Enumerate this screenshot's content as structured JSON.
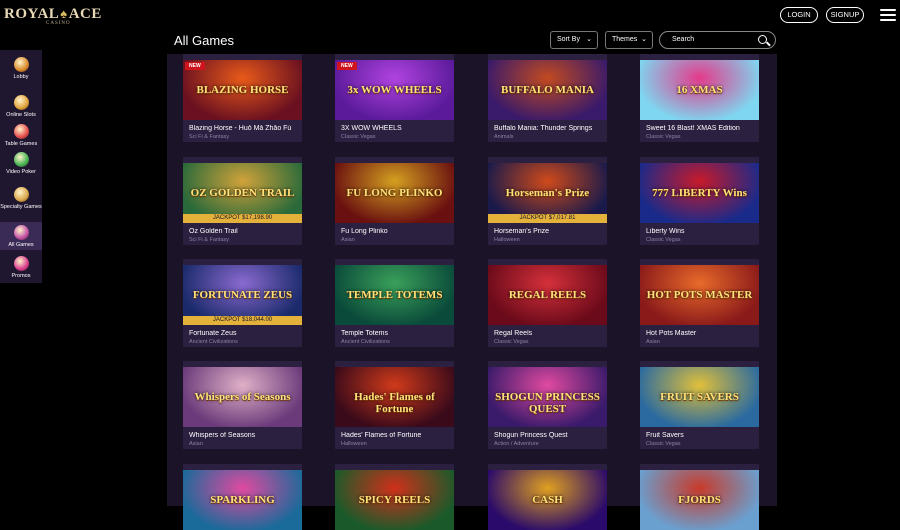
{
  "brand": {
    "name_left": "ROYAL",
    "name_right": "ACE",
    "sub": "CASINO"
  },
  "header": {
    "login": "LOGIN",
    "signup": "SIGNUP"
  },
  "sidebar": {
    "items": [
      {
        "label": "Lobby",
        "icon": "lobby-icon",
        "color": "#d98a2b"
      },
      {
        "label": "Online Slots",
        "icon": "slots-icon",
        "color": "#e0a23a"
      },
      {
        "label": "Table Games",
        "icon": "table-games-icon",
        "color": "#e24b4b"
      },
      {
        "label": "Video Poker",
        "icon": "video-poker-icon",
        "color": "#3fb24f"
      },
      {
        "label": "Specialty Games",
        "icon": "specialty-games-icon",
        "color": "#d8a64a"
      },
      {
        "label": "All Games",
        "icon": "all-games-icon",
        "color": "#c24ea8"
      },
      {
        "label": "Promos",
        "icon": "promos-icon",
        "color": "#d83a8e"
      }
    ]
  },
  "main": {
    "title": "All Games",
    "sort_label": "Sort By",
    "themes_label": "Themes",
    "search_placeholder": "Search"
  },
  "games": [
    {
      "name": "Blazing Horse - Huǒ Mǎ Zhāo Fú",
      "category": "Sci Fi & Fantasy",
      "logo": "BLAZING HORSE",
      "badge": "NEW",
      "jackpot": "",
      "c1": "#6a1020",
      "c2": "#e85a1a"
    },
    {
      "name": "3X WOW WHEELS",
      "category": "Classic Vegas",
      "logo": "3x WOW WHEELS",
      "badge": "NEW",
      "jackpot": "",
      "c1": "#5a1a9a",
      "c2": "#b043e0"
    },
    {
      "name": "Buffalo Mania: Thunder Springs",
      "category": "Animals",
      "logo": "BUFFALO MANIA",
      "badge": "",
      "jackpot": "",
      "c1": "#3a1a6a",
      "c2": "#c24a20"
    },
    {
      "name": "Sweet 16 Blast! XMAS Edition",
      "category": "Classic Vegas",
      "logo": "16 XMAS",
      "badge": "",
      "jackpot": "",
      "c1": "#7fd6f0",
      "c2": "#e43a8a"
    },
    {
      "name": "Oz Golden Trail",
      "category": "Sci Fi & Fantasy",
      "logo": "OZ GOLDEN TRAIL",
      "badge": "",
      "jackpot": "JACKPOT $17,198.90",
      "c1": "#2a6a3a",
      "c2": "#d0a23a"
    },
    {
      "name": "Fu Long Plinko",
      "category": "Asian",
      "logo": "FU LONG PLINKO",
      "badge": "",
      "jackpot": "",
      "c1": "#6a1010",
      "c2": "#d4a020"
    },
    {
      "name": "Horseman's Prize",
      "category": "Halloween",
      "logo": "Horseman's Prize",
      "badge": "",
      "jackpot": "JACKPOT $7,017.81",
      "c1": "#1a1a4a",
      "c2": "#d04a1a"
    },
    {
      "name": "Liberty Wins",
      "category": "Classic Vegas",
      "logo": "777 LIBERTY Wins",
      "badge": "",
      "jackpot": "",
      "c1": "#1a2a8a",
      "c2": "#c81a2a"
    },
    {
      "name": "Fortunate Zeus",
      "category": "Ancient Civilizations",
      "logo": "FORTUNATE ZEUS",
      "badge": "",
      "jackpot": "JACKPOT $18,044.00",
      "c1": "#1a2a6a",
      "c2": "#8a6ad0"
    },
    {
      "name": "Temple Totems",
      "category": "Ancient Civilizations",
      "logo": "TEMPLE TOTEMS",
      "badge": "",
      "jackpot": "",
      "c1": "#0a4a3a",
      "c2": "#3aa05a"
    },
    {
      "name": "Regal Reels",
      "category": "Classic Vegas",
      "logo": "REGAL REELS",
      "badge": "",
      "jackpot": "",
      "c1": "#6a0a1a",
      "c2": "#d4303a"
    },
    {
      "name": "Hot Pots Master",
      "category": "Asian",
      "logo": "HOT POTS MASTER",
      "badge": "",
      "jackpot": "",
      "c1": "#8a1a1a",
      "c2": "#e86a2a"
    },
    {
      "name": "Whispers of Seasons",
      "category": "Asian",
      "logo": "Whispers of Seasons",
      "badge": "",
      "jackpot": "",
      "c1": "#6a3a7a",
      "c2": "#e0b0c8"
    },
    {
      "name": "Hades' Flames of Fortune",
      "category": "Halloween",
      "logo": "Hades' Flames of Fortune",
      "badge": "",
      "jackpot": "",
      "c1": "#3a0a1a",
      "c2": "#d03a1a"
    },
    {
      "name": "Shogun Princess Quest",
      "category": "Action / Adventure",
      "logo": "SHOGUN PRINCESS QUEST",
      "badge": "",
      "jackpot": "",
      "c1": "#3a1a6a",
      "c2": "#e04aa0"
    },
    {
      "name": "Fruit Savers",
      "category": "Classic Vegas",
      "logo": "FRUIT SAVERS",
      "badge": "",
      "jackpot": "",
      "c1": "#2a6aa0",
      "c2": "#e0c03a"
    },
    {
      "name": "",
      "category": "",
      "logo": "SPARKLING",
      "badge": "",
      "jackpot": "",
      "c1": "#1a6a9a",
      "c2": "#e04aa0"
    },
    {
      "name": "",
      "category": "",
      "logo": "SPICY REELS",
      "badge": "",
      "jackpot": "",
      "c1": "#1a5a2a",
      "c2": "#d0301a"
    },
    {
      "name": "",
      "category": "",
      "logo": "CASH",
      "badge": "",
      "jackpot": "",
      "c1": "#2a0a6a",
      "c2": "#e0a020"
    },
    {
      "name": "",
      "category": "",
      "logo": "FJORDS",
      "badge": "",
      "jackpot": "",
      "c1": "#6aa0d0",
      "c2": "#c83a2a"
    }
  ]
}
